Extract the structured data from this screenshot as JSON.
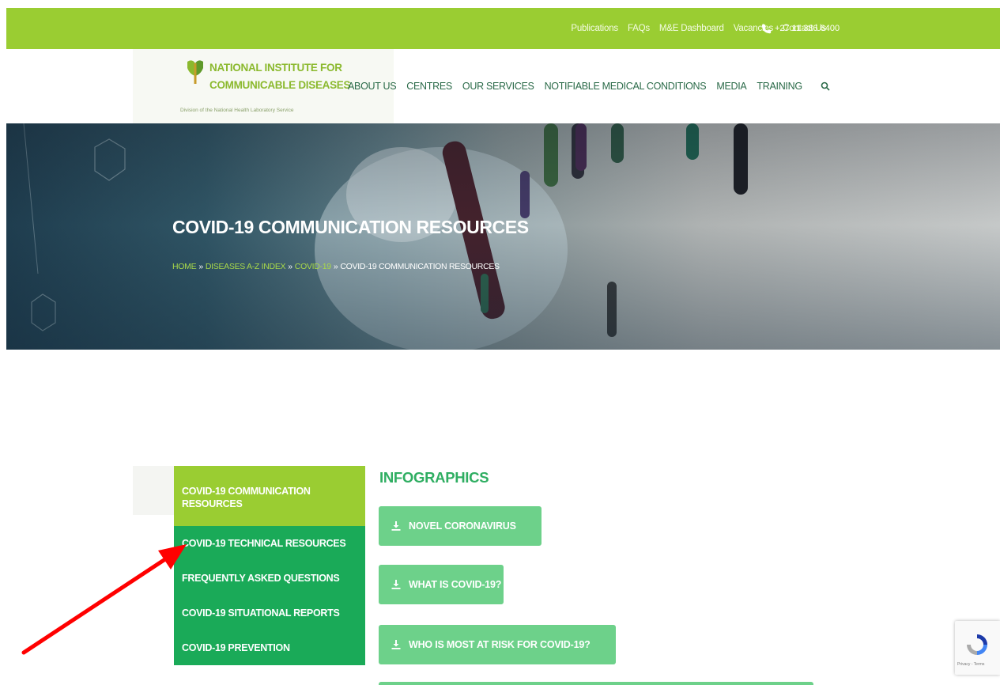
{
  "topbar": {
    "links": [
      "Publications",
      "FAQs",
      "M&E Dashboard",
      "Vacancies",
      "Contact Us"
    ],
    "phone": "+27 11 386 6400",
    "icon": "phone-icon"
  },
  "header": {
    "logo_line1": "NATIONAL INSTITUTE FOR",
    "logo_line2": "COMMUNICABLE DISEASES",
    "logo_sub": "Division of the National Health Laboratory Service",
    "nav": [
      "ABOUT US",
      "CENTRES",
      "OUR SERVICES",
      "NOTIFIABLE MEDICAL CONDITIONS",
      "MEDIA",
      "TRAINING"
    ],
    "search_icon": "search-icon"
  },
  "hero": {
    "title": "COVID-19 COMMUNICATION RESOURCES",
    "breadcrumb": [
      "HOME",
      "DISEASES A-Z INDEX",
      "COVID-19"
    ],
    "breadcrumb_current": "COVID-19 COMMUNICATION RESOURCES",
    "separator": "»"
  },
  "sidebar": {
    "active": "COVID-19 COMMUNICATION RESOURCES",
    "items": [
      "COVID-19 TECHNICAL RESOURCES",
      "FREQUENTLY ASKED QUESTIONS",
      "COVID-19 SITUATIONAL REPORTS",
      "COVID-19 PREVENTION"
    ]
  },
  "content": {
    "heading": "INFOGRAPHICS",
    "buttons": [
      "NOVEL CORONAVIRUS",
      "WHAT IS COVID-19?",
      "WHO IS MOST AT RISK FOR COVID-19?"
    ],
    "button_icon": "download-icon"
  },
  "recaptcha": {
    "terms": "Privacy - Terms"
  },
  "colors": {
    "brand_green": "#9acd32",
    "sidebar_green": "#1aaa58",
    "button_green": "#6dd18a",
    "heading_green": "#2fae62",
    "arrow_red": "#ff0000"
  }
}
